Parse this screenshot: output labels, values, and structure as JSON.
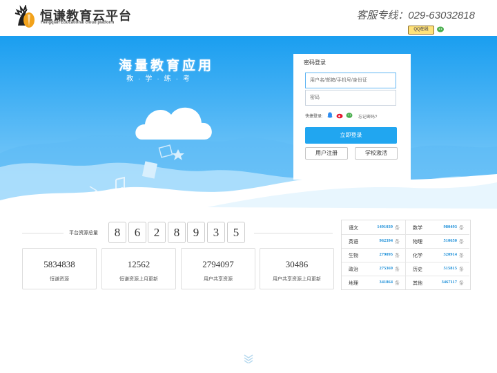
{
  "header": {
    "title": "恒谦教育云平台",
    "subtitle": "Hengqian Educational cloud platform",
    "hotline": "客服专线：029-63032818",
    "qq_label": "QQ在线"
  },
  "banner": {
    "slogan": "海量教育应用",
    "sub_slogan": "教·学·练·考"
  },
  "login": {
    "title": "密码登录",
    "username_placeholder": "用户名/邮箱/手机号/身份证",
    "password_placeholder": "密码",
    "quick_login_label": "快捷登录:",
    "forgot_label": "忘记密码?",
    "submit_label": "立即登录",
    "register_label": "用户注册",
    "activate_label": "学校激活"
  },
  "stats": {
    "total_label": "平台资源总量",
    "digits": [
      "8",
      "6",
      "2",
      "8",
      "9",
      "3",
      "5"
    ],
    "cards": [
      {
        "value": "5834838",
        "label": "恒谦资源"
      },
      {
        "value": "12562",
        "label": "恒谦资源上月更新"
      },
      {
        "value": "2794097",
        "label": "用户共享资源"
      },
      {
        "value": "30486",
        "label": "用户共享资源上月更新"
      }
    ]
  },
  "subjects": {
    "unit": "条",
    "items": [
      {
        "name": "语文",
        "count": "1491039"
      },
      {
        "name": "数学",
        "count": "980493"
      },
      {
        "name": "英语",
        "count": "962394"
      },
      {
        "name": "物理",
        "count": "510650"
      },
      {
        "name": "生物",
        "count": "279095"
      },
      {
        "name": "化学",
        "count": "320914"
      },
      {
        "name": "政治",
        "count": "275369"
      },
      {
        "name": "历史",
        "count": "515815"
      },
      {
        "name": "地理",
        "count": "341864"
      },
      {
        "name": "其他",
        "count": "3467117"
      }
    ]
  },
  "colors": {
    "banner_top": "#1a9ef0",
    "banner_bottom": "#8fd2fb",
    "login_button": "#21a6f0",
    "subject_count": "#1a8ed8"
  },
  "icons": [
    "logo-icon",
    "qq-icon",
    "wechat-icon",
    "weibo-icon",
    "cloud-icon",
    "scroll-down-icon"
  ]
}
